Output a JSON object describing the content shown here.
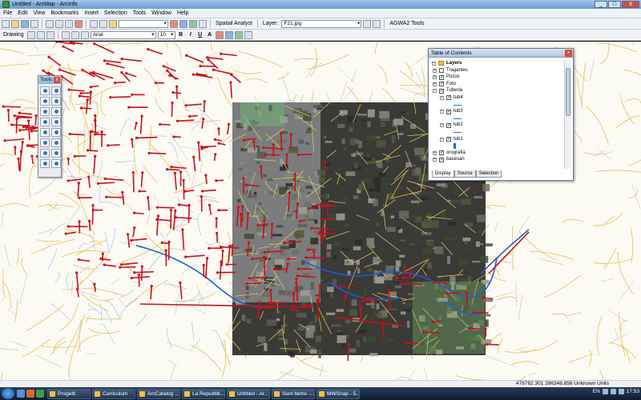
{
  "window": {
    "title": "Untitled - ArcMap - ArcInfo",
    "buttons": [
      "_",
      "□",
      "X"
    ]
  },
  "menu": [
    "File",
    "Edit",
    "View",
    "Bookmarks",
    "Insert",
    "Selection",
    "Tools",
    "Window",
    "Help"
  ],
  "toolbar1": {
    "scale_value": "",
    "spatial_analyst_label": "Spatial Analyst",
    "layer_label": "Layer:",
    "layer_value": "F21.jpg",
    "agwa_label": "AGWA2 Tools"
  },
  "toolbar2": {
    "drawing_label": "Drawing",
    "font_name": "Arial",
    "font_size": "10",
    "bold": "B",
    "italic": "I",
    "underline": "U",
    "text_tool": "A"
  },
  "tools_window": {
    "title": "Tools",
    "close": "x"
  },
  "toc": {
    "title": "Table of Contents",
    "close": "x",
    "root": "Layers",
    "rows": [
      {
        "label": "Tragantes",
        "checked": false
      },
      {
        "label": "Pozos",
        "checked": true
      },
      {
        "label": "Foto",
        "checked": true
      },
      {
        "label": "Tuberia",
        "checked": true
      },
      {
        "label": "tub4",
        "checked": true
      },
      {
        "label": "tub3",
        "checked": true
      },
      {
        "label": "tub2",
        "checked": true
      },
      {
        "label": "tub1",
        "checked": true
      },
      {
        "label": "orografia",
        "checked": true
      },
      {
        "label": "basesan",
        "checked": true
      }
    ],
    "tabs": [
      "Display",
      "Source",
      "Selection"
    ]
  },
  "status": {
    "coords": "478762.301  286348.856 Unknown Units"
  },
  "taskbar": {
    "tasks": [
      "Progetti",
      "Curriculum",
      "ArcCatalog ...",
      "La Repubbli...",
      "Untitled - Ar...",
      "Sent Items -...",
      "MWSnap - 5..."
    ],
    "lang": "EN",
    "clock": "17:53"
  },
  "colors": {
    "pipe_red": "#c8101a",
    "stream_blue": "#1e5cd6",
    "road_yellow": "#e2c25a",
    "contour_blue": "#9cc0e6",
    "photo_dark": "#3a3a36"
  }
}
